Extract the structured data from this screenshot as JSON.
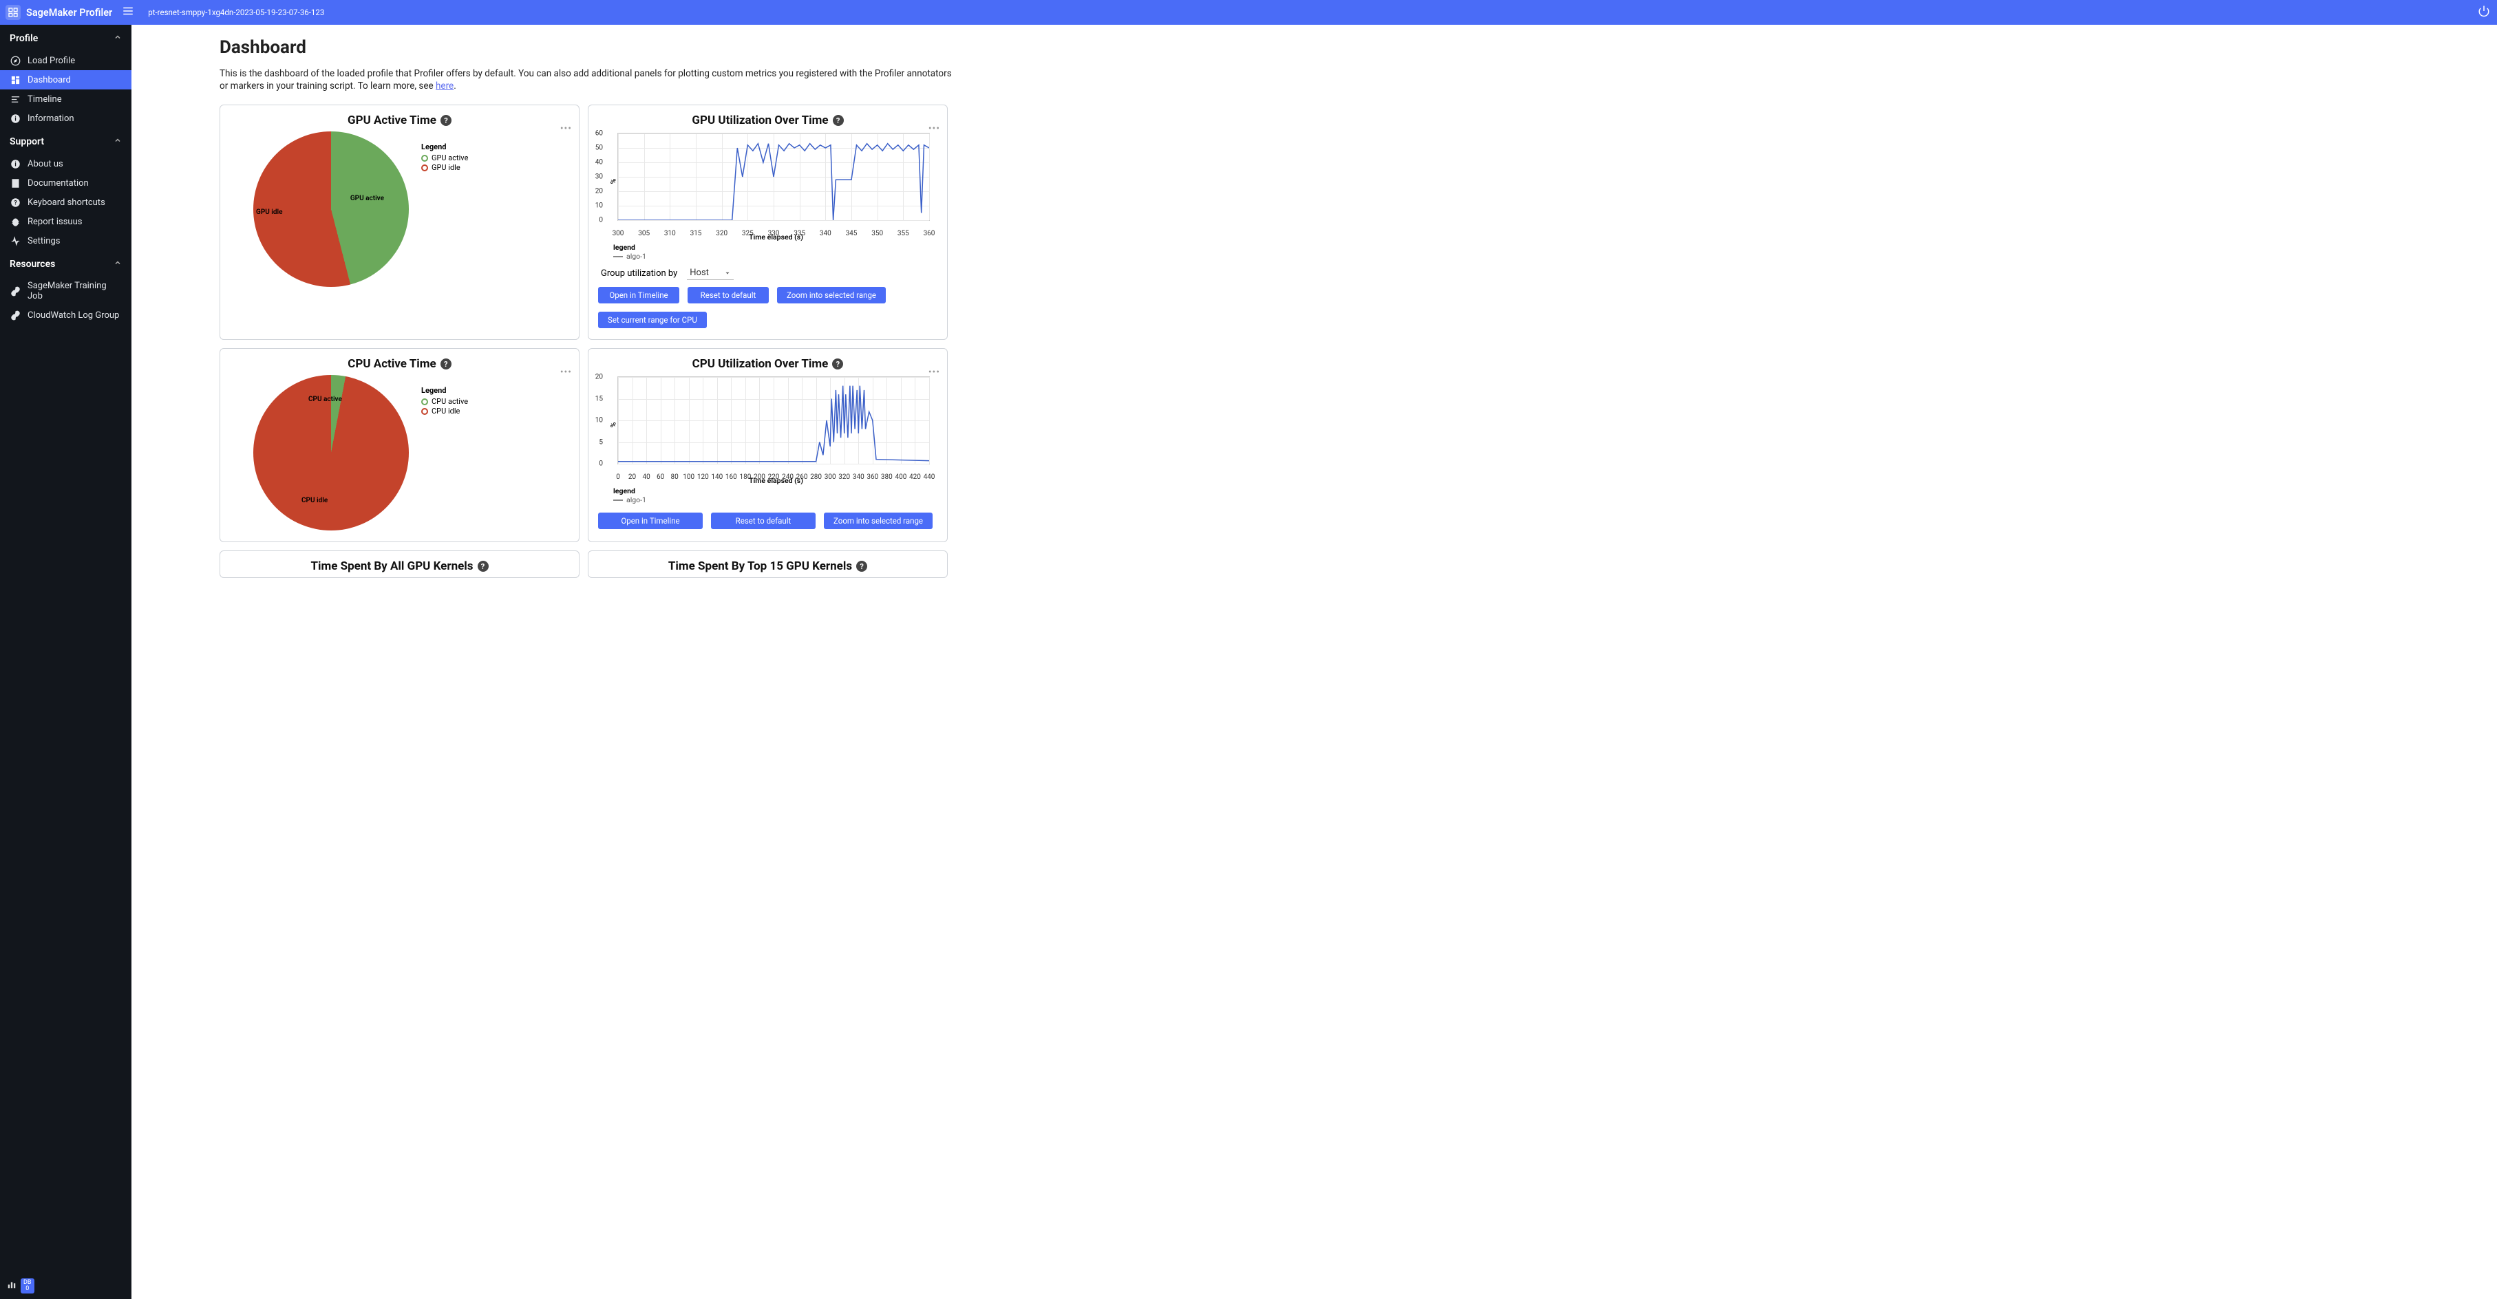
{
  "header": {
    "app_title": "SageMaker Profiler",
    "job_name": "pt-resnet-smppy-1xg4dn-2023-05-19-23-07-36-123"
  },
  "sidebar": {
    "sections": {
      "profile": {
        "title": "Profile",
        "items": [
          {
            "label": "Load Profile",
            "icon": "compass"
          },
          {
            "label": "Dashboard",
            "icon": "dashboard",
            "active": true
          },
          {
            "label": "Timeline",
            "icon": "timeline"
          },
          {
            "label": "Information",
            "icon": "info"
          }
        ]
      },
      "support": {
        "title": "Support",
        "items": [
          {
            "label": "About us",
            "icon": "info"
          },
          {
            "label": "Documentation",
            "icon": "doc"
          },
          {
            "label": "Keyboard shortcuts",
            "icon": "help"
          },
          {
            "label": "Report issuus",
            "icon": "bug"
          },
          {
            "label": "Settings",
            "icon": "settings"
          }
        ]
      },
      "resources": {
        "title": "Resources",
        "items": [
          {
            "label": "SageMaker Training Job",
            "icon": "link"
          },
          {
            "label": "CloudWatch Log Group",
            "icon": "link"
          }
        ]
      }
    },
    "footer_badge": {
      "label": "DB",
      "count": "0"
    }
  },
  "page": {
    "title": "Dashboard",
    "desc_prefix": "This is the dashboard of the loaded profile that Profiler offers by default. You can also add additional panels for plotting custom metrics you registered with the Profiler annotators or markers in your training script. To learn more, see ",
    "desc_link": "here",
    "desc_suffix": "."
  },
  "cards": {
    "gpu_pie": {
      "title": "GPU Active Time",
      "legend_title": "Legend",
      "legend": [
        {
          "label": "GPU active",
          "color": "#6ba95b"
        },
        {
          "label": "GPU idle",
          "color": "#c4432b"
        }
      ],
      "slice_labels": {
        "active": "GPU active",
        "idle": "GPU idle"
      }
    },
    "cpu_pie": {
      "title": "CPU Active Time",
      "legend_title": "Legend",
      "legend": [
        {
          "label": "CPU active",
          "color": "#6ba95b"
        },
        {
          "label": "CPU idle",
          "color": "#c4432b"
        }
      ],
      "slice_labels": {
        "active": "CPU active",
        "idle": "CPU idle"
      }
    },
    "gpu_util": {
      "title": "GPU Utilization Over Time",
      "ylabel": "%",
      "xlabel": "Time elapsed (s)",
      "legend_title": "legend",
      "legend_item": "algo-1",
      "group_label": "Group utilization by",
      "group_value": "Host",
      "buttons": [
        "Open in Timeline",
        "Reset to default",
        "Zoom into selected range",
        "Set current range for CPU"
      ]
    },
    "cpu_util": {
      "title": "CPU Utilization Over Time",
      "ylabel": "%",
      "xlabel": "Time elapsed (s)",
      "legend_title": "legend",
      "legend_item": "algo-1",
      "buttons": [
        "Open in Timeline",
        "Reset to default",
        "Zoom into selected range"
      ]
    },
    "gpu_kernels_all": {
      "title": "Time Spent By All GPU Kernels"
    },
    "gpu_kernels_top": {
      "title": "Time Spent By Top 15 GPU Kernels"
    }
  },
  "chart_data": [
    {
      "id": "gpu_active_pie",
      "type": "pie",
      "title": "GPU Active Time",
      "series": [
        {
          "name": "GPU active",
          "value": 46,
          "color": "#6ba95b"
        },
        {
          "name": "GPU idle",
          "value": 54,
          "color": "#c4432b"
        }
      ]
    },
    {
      "id": "cpu_active_pie",
      "type": "pie",
      "title": "CPU Active Time",
      "series": [
        {
          "name": "CPU active",
          "value": 3,
          "color": "#6ba95b"
        },
        {
          "name": "CPU idle",
          "value": 97,
          "color": "#c4432b"
        }
      ]
    },
    {
      "id": "gpu_util_line",
      "type": "line",
      "title": "GPU Utilization Over Time",
      "xlabel": "Time elapsed (s)",
      "ylabel": "%",
      "x_ticks": [
        300,
        305,
        310,
        315,
        320,
        325,
        330,
        335,
        340,
        345,
        350,
        355,
        360
      ],
      "y_ticks": [
        0,
        10,
        20,
        30,
        40,
        50,
        60
      ],
      "ylim": [
        0,
        60
      ],
      "xlim": [
        300,
        360
      ],
      "series": [
        {
          "name": "algo-1",
          "color": "#3a5fc8",
          "x": [
            300,
            322,
            323,
            324,
            325,
            326,
            327,
            328,
            329,
            330,
            331,
            332,
            333,
            334,
            335,
            336,
            337,
            338,
            339,
            340,
            341,
            341.5,
            342,
            345,
            346,
            347,
            348,
            349,
            350,
            351,
            352,
            353,
            354,
            355,
            356,
            357,
            358,
            358.5,
            359,
            360
          ],
          "y": [
            0,
            0,
            50,
            30,
            52,
            48,
            53,
            40,
            53,
            30,
            52,
            48,
            53,
            50,
            52,
            48,
            53,
            49,
            52,
            50,
            52,
            0,
            28,
            28,
            52,
            48,
            53,
            49,
            52,
            48,
            53,
            49,
            52,
            48,
            52,
            49,
            52,
            5,
            52,
            50
          ]
        }
      ]
    },
    {
      "id": "cpu_util_line",
      "type": "line",
      "title": "CPU Utilization Over Time",
      "xlabel": "Time elapsed (s)",
      "ylabel": "%",
      "x_ticks": [
        0,
        20,
        40,
        60,
        80,
        100,
        120,
        140,
        160,
        180,
        200,
        220,
        240,
        260,
        280,
        300,
        320,
        340,
        360,
        380,
        400,
        420,
        440
      ],
      "y_ticks": [
        0,
        5,
        10,
        15,
        20
      ],
      "ylim": [
        0,
        20
      ],
      "xlim": [
        0,
        440
      ],
      "series": [
        {
          "name": "algo-1",
          "color": "#3a5fc8",
          "x": [
            0,
            280,
            285,
            290,
            295,
            300,
            302,
            305,
            308,
            310,
            312,
            315,
            318,
            320,
            322,
            325,
            328,
            330,
            332,
            335,
            338,
            340,
            342,
            345,
            348,
            350,
            355,
            360,
            365,
            440
          ],
          "y": [
            0.5,
            0.5,
            5,
            2,
            10,
            4,
            15,
            5,
            17,
            7,
            16,
            6,
            18,
            7,
            16,
            6,
            18,
            7,
            18,
            8,
            17,
            7,
            18,
            8,
            17,
            8,
            12,
            10,
            1,
            0.7
          ]
        }
      ]
    }
  ]
}
